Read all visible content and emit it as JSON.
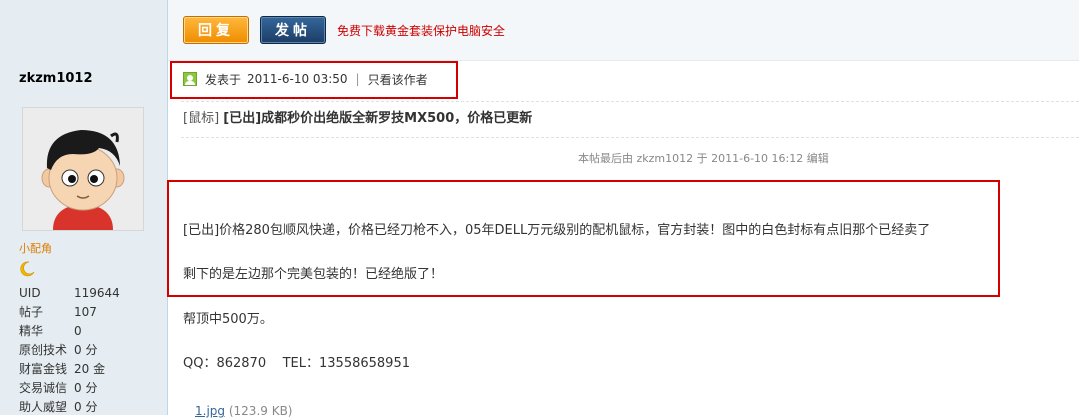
{
  "sidebar": {
    "username": "zkzm1012",
    "avatar": "cartoon-boy-avatar",
    "user_group": "小配角",
    "rank_icon": "moon-icon",
    "stats": [
      {
        "label": "UID",
        "value": "119644"
      },
      {
        "label": "帖子",
        "value": "107"
      },
      {
        "label": "精华",
        "value": "0"
      },
      {
        "label": "原创技术",
        "value": "0 分"
      },
      {
        "label": "财富金钱",
        "value": "20 金"
      },
      {
        "label": "交易诚信",
        "value": "0 分"
      },
      {
        "label": "助人威望",
        "value": "0 分"
      }
    ]
  },
  "toolbar": {
    "reply_label": "回复",
    "post_label": "发帖",
    "promo_text": "免费下载黄金套装保护电脑安全"
  },
  "post": {
    "posted_prefix": "发表于",
    "posted_time": "2011-6-10 03:50",
    "author_only": "只看该作者",
    "category": "[鼠标]",
    "title": "[已出]成都秒价出绝版全新罗技MX500，价格已更新",
    "edit_note": "本帖最后由 zkzm1012 于 2011-6-10 16:12 编辑",
    "content_line1": "[已出]价格280包顺风快递，价格已经刀枪不入，05年DELL万元级别的配机鼠标，官方封装！图中的白色封标有点旧那个已经卖了",
    "content_line2": "剩下的是左边那个完美包装的！已经绝版了！",
    "content_line3": "帮顶中500万。",
    "content_line4": "QQ：862870    TEL：13558658951",
    "attachment_name": "1.jpg",
    "attachment_size": "(123.9 KB)"
  },
  "colors": {
    "highlight_frame": "#d40000",
    "sidebar_bg": "#e5edf2",
    "reply_button": "#f08c00",
    "post_button": "#1c3d66",
    "promo_text": "#cc0000"
  }
}
